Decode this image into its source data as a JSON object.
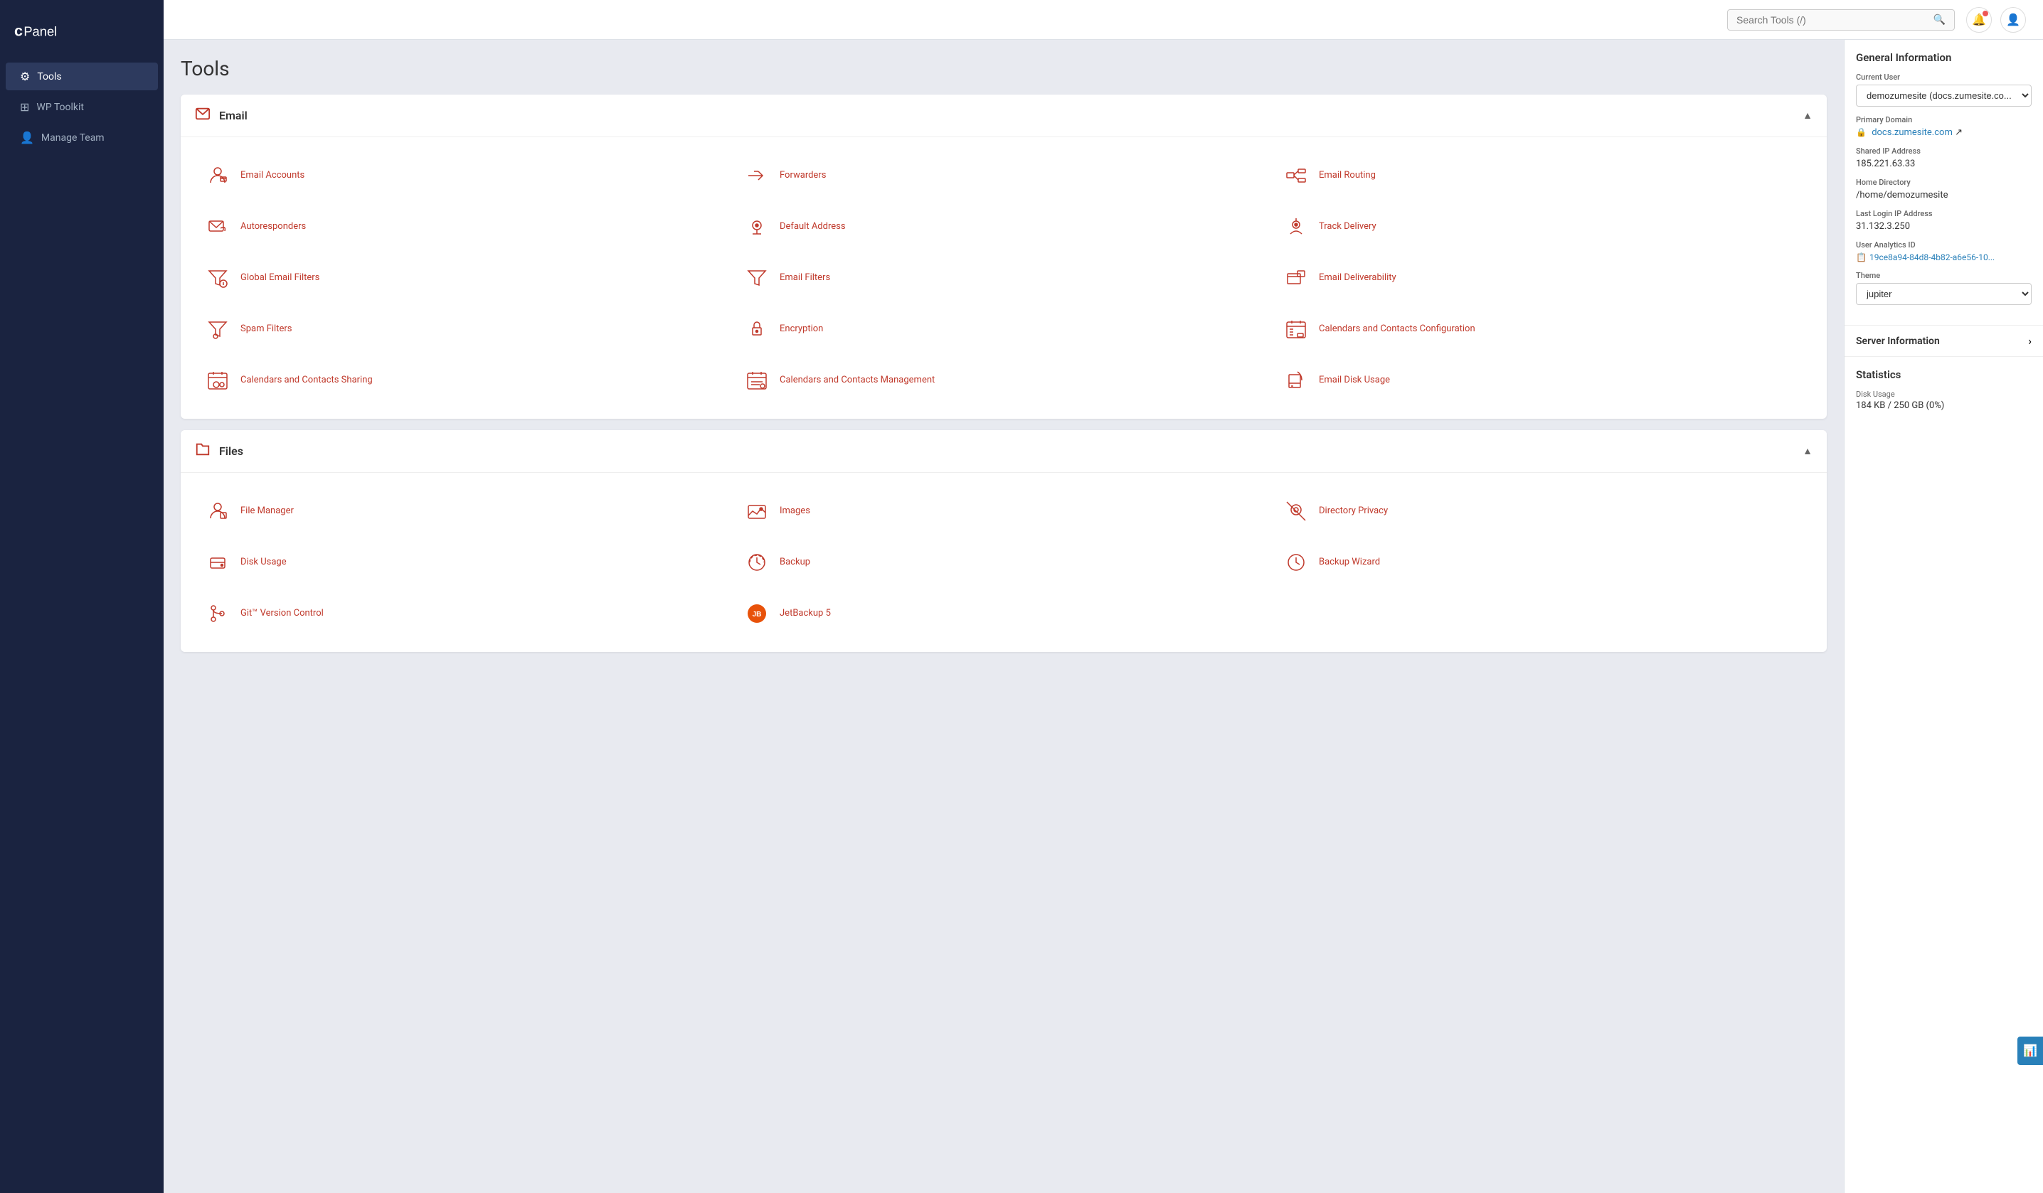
{
  "sidebar": {
    "logo_text": "cPanel",
    "items": [
      {
        "id": "tools",
        "label": "Tools",
        "icon": "⚙",
        "active": true
      },
      {
        "id": "wp-toolkit",
        "label": "WP Toolkit",
        "icon": "🔵",
        "active": false
      },
      {
        "id": "manage-team",
        "label": "Manage Team",
        "icon": "👤",
        "active": false
      }
    ]
  },
  "header": {
    "search_placeholder": "Search Tools (/)",
    "search_label": "Search Tools"
  },
  "page": {
    "title": "Tools"
  },
  "sections": [
    {
      "id": "email",
      "title": "Email",
      "collapsed": false,
      "tools": [
        {
          "id": "email-accounts",
          "label": "Email Accounts"
        },
        {
          "id": "forwarders",
          "label": "Forwarders"
        },
        {
          "id": "email-routing",
          "label": "Email Routing"
        },
        {
          "id": "autoresponders",
          "label": "Autoresponders"
        },
        {
          "id": "default-address",
          "label": "Default Address"
        },
        {
          "id": "track-delivery",
          "label": "Track Delivery"
        },
        {
          "id": "global-email-filters",
          "label": "Global Email Filters"
        },
        {
          "id": "email-filters",
          "label": "Email Filters"
        },
        {
          "id": "email-deliverability",
          "label": "Email Deliverability"
        },
        {
          "id": "spam-filters",
          "label": "Spam Filters"
        },
        {
          "id": "encryption",
          "label": "Encryption"
        },
        {
          "id": "calendars-contacts-config",
          "label": "Calendars and Contacts Configuration"
        },
        {
          "id": "calendars-contacts-sharing",
          "label": "Calendars and Contacts Sharing"
        },
        {
          "id": "calendars-contacts-management",
          "label": "Calendars and Contacts Management"
        },
        {
          "id": "email-disk-usage",
          "label": "Email Disk Usage"
        }
      ]
    },
    {
      "id": "files",
      "title": "Files",
      "collapsed": false,
      "tools": [
        {
          "id": "file-manager",
          "label": "File Manager"
        },
        {
          "id": "images",
          "label": "Images"
        },
        {
          "id": "directory-privacy",
          "label": "Directory Privacy"
        },
        {
          "id": "disk-usage",
          "label": "Disk Usage"
        },
        {
          "id": "backup",
          "label": "Backup"
        },
        {
          "id": "backup-wizard",
          "label": "Backup Wizard"
        },
        {
          "id": "git-version-control",
          "label": "Git™ Version Control"
        },
        {
          "id": "jetbackup5",
          "label": "JetBackup 5"
        }
      ]
    }
  ],
  "right_panel": {
    "general_info": {
      "title": "General Information",
      "current_user_label": "Current User",
      "current_user_value": "demozumesite (docs.zumesite.co...",
      "primary_domain_label": "Primary Domain",
      "primary_domain_value": "docs.zumesite.com",
      "shared_ip_label": "Shared IP Address",
      "shared_ip_value": "185.221.63.33",
      "home_directory_label": "Home Directory",
      "home_directory_value": "/home/demozumesite",
      "last_login_ip_label": "Last Login IP Address",
      "last_login_ip_value": "31.132.3.250",
      "user_analytics_label": "User Analytics ID",
      "user_analytics_value": "19ce8a94-84d8-4b82-a6e56-10...",
      "theme_label": "Theme",
      "theme_value": "jupiter"
    },
    "server_info": {
      "label": "Server Information"
    },
    "statistics": {
      "title": "Statistics",
      "disk_usage_label": "Disk Usage",
      "disk_usage_value": "184 KB / 250 GB  (0%)"
    }
  }
}
